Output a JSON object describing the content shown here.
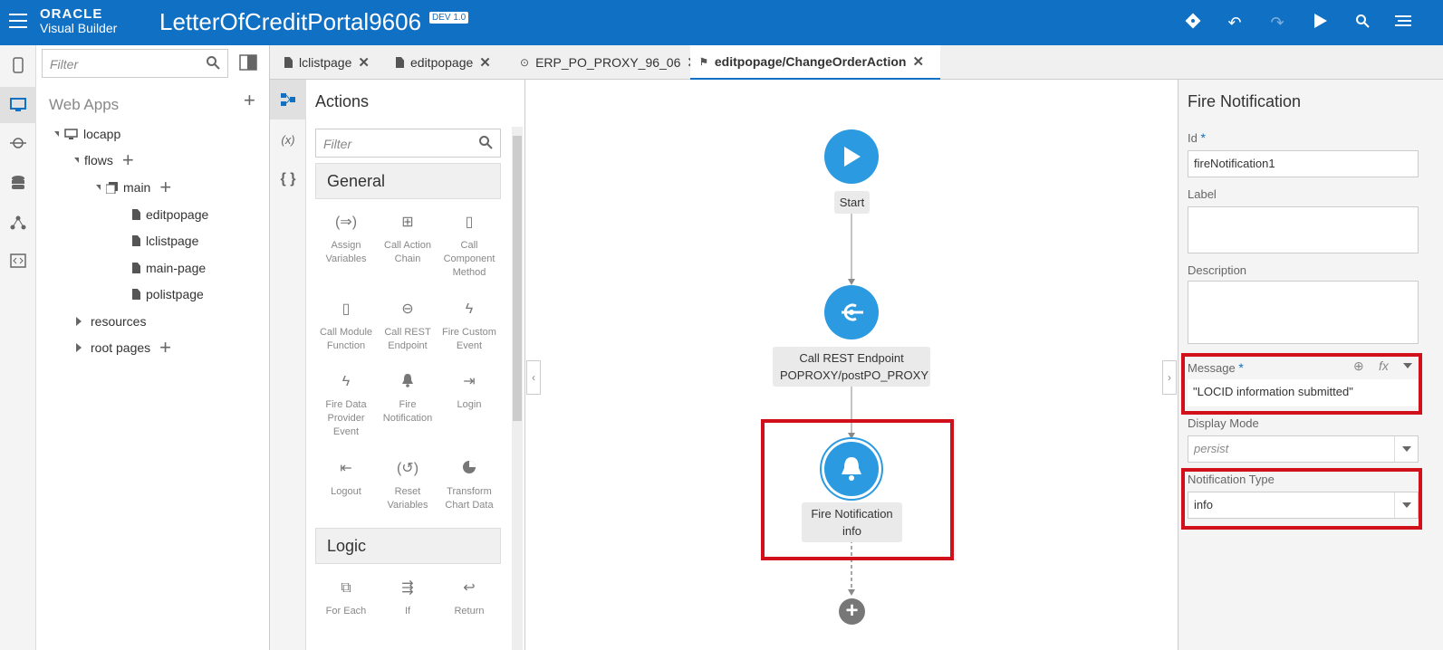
{
  "header": {
    "brand_top": "ORACLE",
    "brand_bottom": "Visual Builder",
    "app_title": "LetterOfCreditPortal9606",
    "env_badge": "DEV 1.0",
    "icons": [
      "git-icon",
      "undo-icon",
      "redo-icon",
      "run-icon",
      "search-icon",
      "menu-icon"
    ]
  },
  "left_rail": [
    "mobile-apps-icon",
    "web-apps-icon",
    "service-connections-icon",
    "business-objects-icon",
    "processes-icon",
    "source-view-icon"
  ],
  "navigator": {
    "filter_placeholder": "Filter",
    "section_title": "Web Apps",
    "tree": {
      "app": "locapp",
      "flows": "flows",
      "main": "main",
      "pages": [
        "editpopage",
        "lclistpage",
        "main-page",
        "polistpage"
      ],
      "resources": "resources",
      "root_pages": "root pages"
    }
  },
  "tabs": [
    {
      "label": "lclistpage",
      "icon": "page-icon"
    },
    {
      "label": "editpopage",
      "icon": "page-icon"
    },
    {
      "label": "ERP_PO_PROXY_96_06",
      "icon": "service-icon"
    },
    {
      "label": "editpopage/ChangeOrderAction",
      "icon": "action-chain-icon",
      "active": true
    }
  ],
  "actions_panel": {
    "title": "Actions",
    "filter_placeholder": "Filter",
    "categories": [
      {
        "name": "General",
        "items": [
          {
            "label": "Assign Variables",
            "icon": "assign-variables-icon"
          },
          {
            "label": "Call Action Chain",
            "icon": "call-action-chain-icon"
          },
          {
            "label": "Call Component Method",
            "icon": "call-component-method-icon"
          },
          {
            "label": "Call Module Function",
            "icon": "call-module-function-icon"
          },
          {
            "label": "Call REST Endpoint",
            "icon": "call-rest-endpoint-icon"
          },
          {
            "label": "Fire Custom Event",
            "icon": "fire-custom-event-icon"
          },
          {
            "label": "Fire Data Provider Event",
            "icon": "fire-data-provider-event-icon"
          },
          {
            "label": "Fire Notification",
            "icon": "bell-icon"
          },
          {
            "label": "Login",
            "icon": "login-icon"
          },
          {
            "label": "Logout",
            "icon": "logout-icon"
          },
          {
            "label": "Reset Variables",
            "icon": "reset-variables-icon"
          },
          {
            "label": "Transform Chart Data",
            "icon": "pie-chart-icon"
          }
        ]
      },
      {
        "name": "Logic",
        "items": [
          {
            "label": "For Each",
            "icon": "for-each-icon"
          },
          {
            "label": "If",
            "icon": "if-icon"
          },
          {
            "label": "Return",
            "icon": "return-icon"
          }
        ]
      }
    ]
  },
  "canvas": {
    "start": {
      "label": "Start"
    },
    "rest": {
      "line1": "Call REST Endpoint",
      "line2": "POPROXY/postPO_PROXY"
    },
    "notify": {
      "line1": "Fire Notification",
      "line2": "info"
    }
  },
  "properties": {
    "title": "Fire Notification",
    "id_label": "Id",
    "id_value": "fireNotification1",
    "label_label": "Label",
    "label_value": "",
    "description_label": "Description",
    "description_value": "",
    "message_label": "Message",
    "message_value": "\"LOCID information submitted\"",
    "display_mode_label": "Display Mode",
    "display_mode_value": "persist",
    "notification_type_label": "Notification Type",
    "notification_type_value": "info"
  },
  "colors": {
    "brand_blue": "#1070c4",
    "node_blue": "#2b9ae0",
    "highlight_red": "#d0101a"
  }
}
